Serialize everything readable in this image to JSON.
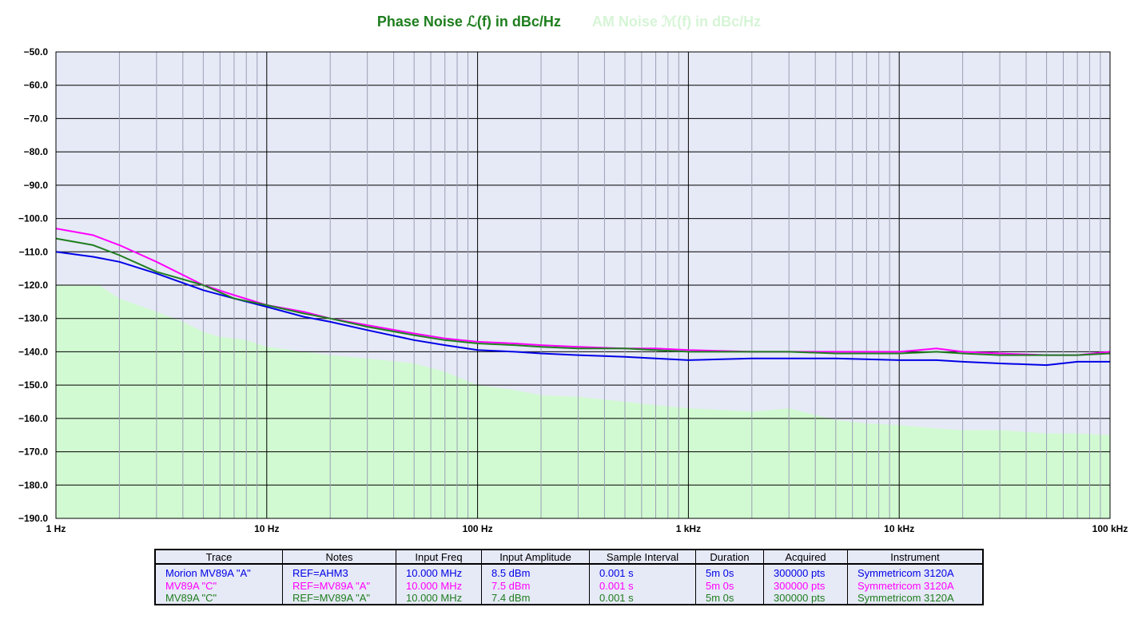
{
  "chart_title": "Phase Noise ℒ(f) in dBc/Hz",
  "chart_subtitle": "AM Noise ℳ(f) in dBc/Hz",
  "colors": {
    "series_blue": "#0000e6",
    "series_magenta": "#ff00ff",
    "series_green": "#1e7e1e",
    "plot_bg": "#e6e9f6",
    "am_fill": "#d2fad2",
    "title_green": "#1e7e1e",
    "title_am": "#d6f5d6"
  },
  "chart_data": {
    "type": "line",
    "x_scale": "log",
    "xlim": [
      1,
      100000
    ],
    "ylim": [
      -190,
      -50
    ],
    "grid": true,
    "legend": "table-below",
    "x_ticks": [
      {
        "value": 1,
        "label": "1 Hz"
      },
      {
        "value": 10,
        "label": "10 Hz"
      },
      {
        "value": 100,
        "label": "100 Hz"
      },
      {
        "value": 1000,
        "label": "1 kHz"
      },
      {
        "value": 10000,
        "label": "10 kHz"
      },
      {
        "value": 100000,
        "label": "100 kHz"
      }
    ],
    "y_ticks": [
      {
        "value": -50,
        "label": "−50.0"
      },
      {
        "value": -60,
        "label": "−60.0"
      },
      {
        "value": -70,
        "label": "−70.0"
      },
      {
        "value": -80,
        "label": "−80.0"
      },
      {
        "value": -90,
        "label": "−90.0"
      },
      {
        "value": -100,
        "label": "−100.0"
      },
      {
        "value": -110,
        "label": "−110.0"
      },
      {
        "value": -120,
        "label": "−120.0"
      },
      {
        "value": -130,
        "label": "−130.0"
      },
      {
        "value": -140,
        "label": "−140.0"
      },
      {
        "value": -150,
        "label": "−150.0"
      },
      {
        "value": -160,
        "label": "−160.0"
      },
      {
        "value": -170,
        "label": "−170.0"
      },
      {
        "value": -180,
        "label": "−180.0"
      },
      {
        "value": -190,
        "label": "−190.0"
      }
    ],
    "series": [
      {
        "name": "Morion MV89A \"A\"",
        "color": "#0000e6",
        "x": [
          1,
          1.5,
          2,
          3,
          5,
          7,
          10,
          15,
          20,
          30,
          50,
          70,
          100,
          150,
          200,
          300,
          500,
          700,
          1000,
          2000,
          3000,
          5000,
          10000,
          15000,
          20000,
          30000,
          50000,
          70000,
          100000
        ],
        "y": [
          -110,
          -111.5,
          -113,
          -116.5,
          -121.5,
          -124,
          -126.5,
          -129.5,
          -131,
          -133.5,
          -136.5,
          -138,
          -139.5,
          -140,
          -140.5,
          -141,
          -141.5,
          -142,
          -142.5,
          -142,
          -142,
          -142,
          -142.5,
          -142.5,
          -143,
          -143.5,
          -144,
          -143,
          -143
        ]
      },
      {
        "name": "MV89A \"C\"",
        "color": "#ff00ff",
        "x": [
          1,
          1.5,
          2,
          3,
          5,
          7,
          10,
          15,
          20,
          30,
          50,
          70,
          100,
          150,
          200,
          300,
          500,
          700,
          1000,
          2000,
          3000,
          5000,
          10000,
          15000,
          20000,
          30000,
          50000,
          70000,
          100000
        ],
        "y": [
          -103,
          -105,
          -108,
          -113,
          -120,
          -123,
          -126,
          -128,
          -130,
          -132,
          -134.5,
          -136,
          -137,
          -137.5,
          -138,
          -138.5,
          -139,
          -139,
          -139.5,
          -140,
          -140,
          -140,
          -140,
          -139,
          -140,
          -140.5,
          -141,
          -141,
          -140
        ]
      },
      {
        "name": "MV89A \"C\"",
        "color": "#1e7e1e",
        "x": [
          1,
          1.5,
          2,
          3,
          5,
          7,
          10,
          15,
          20,
          30,
          50,
          70,
          100,
          150,
          200,
          300,
          500,
          700,
          1000,
          2000,
          3000,
          5000,
          10000,
          15000,
          20000,
          30000,
          50000,
          70000,
          100000
        ],
        "y": [
          -106,
          -108,
          -111,
          -116,
          -120,
          -124,
          -126,
          -128.5,
          -130,
          -132.5,
          -135,
          -136.5,
          -137.5,
          -138,
          -138.5,
          -139,
          -139,
          -139.5,
          -140,
          -140,
          -140,
          -140.5,
          -140.5,
          -140,
          -140.5,
          -141,
          -141,
          -141,
          -140.5
        ]
      }
    ],
    "am_noise_floor": {
      "x": [
        1,
        1.6,
        2,
        3,
        4,
        5,
        6,
        8,
        10,
        15,
        20,
        30,
        50,
        70,
        100,
        150,
        200,
        300,
        500,
        700,
        1000,
        1500,
        2000,
        3000,
        5000,
        7000,
        10000,
        15000,
        20000,
        30000,
        50000,
        70000,
        100000
      ],
      "y": [
        -120,
        -120,
        -124,
        -128,
        -131,
        -134,
        -135.5,
        -136.5,
        -138.5,
        -140,
        -141,
        -142,
        -143.5,
        -146,
        -150,
        -151.5,
        -153,
        -153.5,
        -155,
        -156,
        -157,
        -157.5,
        -158,
        -157,
        -160.5,
        -161.5,
        -162,
        -163,
        -163.5,
        -163.5,
        -164.5,
        -164.5,
        -165
      ]
    }
  },
  "table": {
    "headers": [
      "Trace",
      "Notes",
      "Input Freq",
      "Input Amplitude",
      "Sample Interval",
      "Duration",
      "Acquired",
      "Instrument"
    ],
    "rows": [
      {
        "color": "#0000e6",
        "cells": [
          "Morion MV89A \"A\"",
          "REF=AHM3",
          "10.000 MHz",
          "8.5 dBm",
          "0.001 s",
          "5m 0s",
          "300000 pts",
          "Symmetricom 3120A"
        ]
      },
      {
        "color": "#ff00ff",
        "cells": [
          "MV89A \"C\"",
          "REF=MV89A \"A\"",
          "10.000 MHz",
          "7.5 dBm",
          "0.001 s",
          "5m 0s",
          "300000 pts",
          "Symmetricom 3120A"
        ]
      },
      {
        "color": "#1e7e1e",
        "cells": [
          "MV89A \"C\"",
          "REF=MV89A \"A\"",
          "10.000 MHz",
          "7.4 dBm",
          "0.001 s",
          "5m 0s",
          "300000 pts",
          "Symmetricom 3120A"
        ]
      }
    ]
  }
}
